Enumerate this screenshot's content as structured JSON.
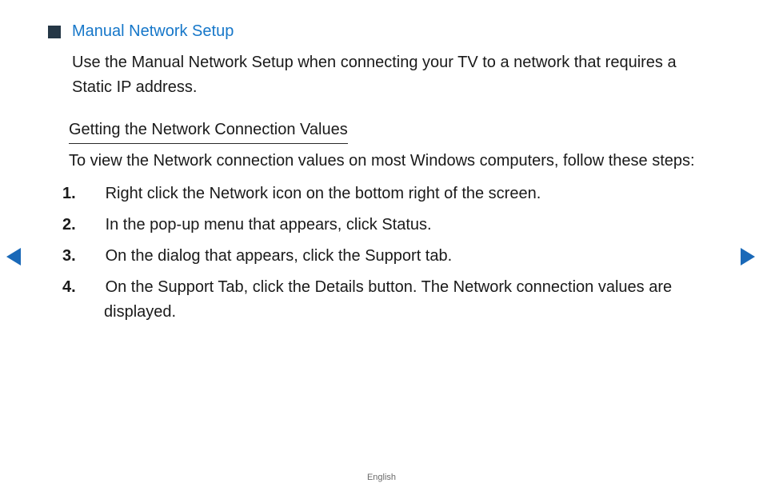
{
  "section": {
    "title": "Manual Network Setup",
    "body": "Use the Manual Network Setup when connecting your TV to a network that requires a Static IP address."
  },
  "subheading": "Getting the Network Connection Values",
  "sub_body": "To view the Network connection values on most Windows computers, follow these steps:",
  "steps": [
    "Right click the Network icon on the bottom right of the screen.",
    "In the pop-up menu that appears, click Status.",
    "On the dialog that appears, click the Support tab.",
    "On the Support Tab, click the Details button. The Network connection values are displayed."
  ],
  "footer": {
    "language": "English"
  },
  "colors": {
    "accent": "#1677c9",
    "arrow": "#1a69b8"
  }
}
